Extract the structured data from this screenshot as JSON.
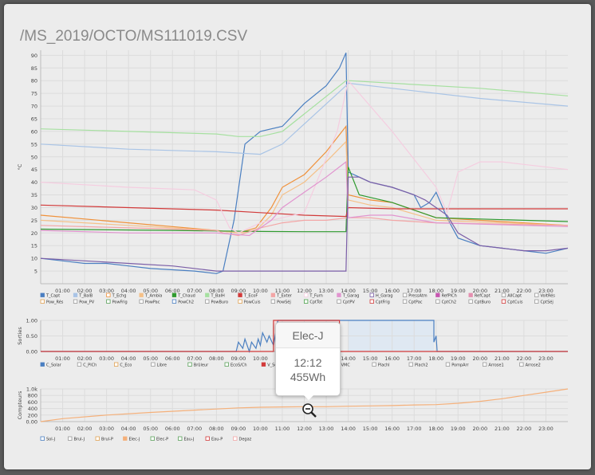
{
  "page": {
    "title": "/MS_2019/OCTO/MS111019.CSV"
  },
  "x_ticks": [
    "01:00",
    "02:00",
    "03:00",
    "04:00",
    "05:00",
    "06:00",
    "07:00",
    "08:00",
    "09:00",
    "10:00",
    "11:00",
    "12:00",
    "13:00",
    "14:00",
    "15:00",
    "16:00",
    "17:00",
    "18:00",
    "19:00",
    "20:00",
    "21:00",
    "22:00",
    "23:00"
  ],
  "tooltip": {
    "title": "Elec-J",
    "time": "12:12",
    "value": "455Wh"
  },
  "chart_data": [
    {
      "type": "line",
      "ylabel": "°C",
      "ylim": [
        0,
        92
      ],
      "yticks": [
        5,
        10,
        15,
        20,
        25,
        30,
        35,
        40,
        45,
        50,
        55,
        60,
        65,
        70,
        75,
        80,
        85,
        90
      ],
      "x_range_hours": [
        0,
        24
      ],
      "grid": true,
      "legend_placement": "bottom",
      "series": [
        {
          "name": "T_Capt",
          "color": "#4a7fc1",
          "x": [
            0,
            1,
            2,
            3,
            4,
            5,
            6,
            7,
            8,
            8.3,
            8.8,
            9.3,
            10,
            11,
            12,
            13,
            13.6,
            13.9,
            14,
            14.5,
            15,
            16,
            17,
            17.3,
            17.7,
            18,
            18.5,
            19,
            20,
            21,
            22,
            23,
            24
          ],
          "y": [
            10,
            9,
            8,
            8,
            7,
            6,
            5.5,
            5,
            4,
            5,
            25,
            55,
            60,
            62,
            71,
            78,
            85,
            91,
            44,
            42,
            40,
            38,
            35,
            30,
            32,
            36,
            26,
            18,
            15,
            14,
            13,
            12,
            14
          ]
        },
        {
          "name": "T_BalB",
          "color": "#a9c4e6",
          "x": [
            0,
            4,
            8,
            10,
            11,
            13.9,
            14,
            16,
            20,
            24
          ],
          "y": [
            55,
            53,
            52,
            51,
            55,
            78,
            79,
            77,
            73,
            70
          ]
        },
        {
          "name": "T_Echg",
          "color": "#f0913a",
          "x": [
            0,
            4,
            8,
            9,
            9.8,
            10.5,
            11,
            12,
            13,
            13.9,
            14,
            14.5,
            15,
            16,
            18,
            24
          ],
          "y": [
            27,
            24,
            21,
            20,
            22,
            30,
            38,
            43,
            52,
            62,
            35,
            34,
            33,
            32,
            26,
            23
          ]
        },
        {
          "name": "T_Ambia",
          "color": "#f5c088",
          "x": [
            0,
            4,
            8,
            9,
            9.8,
            10.5,
            11,
            12,
            13,
            13.9,
            14,
            14.5,
            15,
            16,
            18,
            24
          ],
          "y": [
            25,
            23,
            21,
            20,
            21,
            27,
            35,
            40,
            48,
            56,
            33,
            32,
            31,
            30,
            25,
            23
          ]
        },
        {
          "name": "T_Chaud",
          "color": "#2f9a2f",
          "x": [
            0,
            6,
            8,
            10,
            12,
            13.9,
            14,
            14.5,
            15,
            16,
            18,
            24
          ],
          "y": [
            21.5,
            21,
            20.8,
            20.6,
            20.5,
            20.5,
            46,
            35,
            34,
            32,
            26,
            24.5
          ]
        },
        {
          "name": "T_BalH",
          "color": "#a6e0a0",
          "x": [
            0,
            4,
            8,
            9,
            10,
            11,
            13.9,
            14,
            16,
            20,
            24
          ],
          "y": [
            61,
            60,
            59,
            58,
            58,
            60,
            80,
            80,
            79,
            77,
            74
          ]
        },
        {
          "name": "T_EcoF",
          "color": "#d23a3a",
          "x": [
            0,
            4,
            8,
            10,
            12,
            13.9,
            14,
            16,
            18,
            20,
            24
          ],
          "y": [
            31,
            30,
            29,
            28,
            27,
            26.5,
            30,
            29.5,
            29.5,
            29.5,
            29.5
          ]
        },
        {
          "name": "T_Exter",
          "color": "#f3a6a6",
          "x": [
            0,
            4,
            8,
            8.3,
            9,
            10,
            11,
            12,
            13,
            14,
            15,
            16,
            18,
            24
          ],
          "y": [
            23,
            22,
            21,
            20,
            19,
            22,
            24,
            25,
            25,
            26,
            26,
            25,
            24,
            23
          ]
        },
        {
          "name": "T_Furn",
          "color": "#f5cde0",
          "x": [
            0,
            4,
            7,
            8,
            8.6,
            9,
            9.5,
            10,
            11,
            12,
            13.5,
            14,
            16,
            18,
            18.5,
            19,
            20,
            21,
            22,
            24
          ],
          "y": [
            40,
            38,
            37,
            33,
            22,
            20,
            22,
            24,
            26,
            28,
            60,
            80,
            60,
            38,
            28,
            44,
            48,
            48,
            47,
            45
          ]
        },
        {
          "name": "T_Garag",
          "color": "#e194cf",
          "x": [
            0,
            4,
            8,
            9.5,
            10.5,
            11,
            12,
            13,
            13.9,
            14,
            15,
            16,
            18,
            24
          ],
          "y": [
            21,
            20,
            20,
            19,
            25,
            30,
            36,
            42,
            48,
            26,
            27,
            27,
            24,
            22.5
          ]
        },
        {
          "name": "H_Garag",
          "color": "#7b5ea7",
          "x": [
            0,
            2,
            4,
            6,
            8,
            8.5,
            9,
            10,
            12,
            13,
            13.9,
            14,
            14.5,
            15,
            16,
            17,
            17.5,
            18,
            18.5,
            19,
            20,
            21,
            22,
            23,
            24
          ],
          "y": [
            10,
            9,
            8,
            7,
            5,
            5,
            5,
            5,
            5,
            5,
            5,
            42,
            42,
            40,
            38,
            35,
            33,
            30,
            27,
            20,
            15,
            14,
            13,
            13,
            14
          ]
        }
      ],
      "legend_row1": [
        {
          "name": "T_Capt",
          "color": "#4a7fc1",
          "filled": true
        },
        {
          "name": "T_BalB",
          "color": "#a9c4e6",
          "filled": true
        },
        {
          "name": "T_Echg",
          "color": "#f0913a",
          "filled": false
        },
        {
          "name": "T_Ambia",
          "color": "#f5c088",
          "filled": true
        },
        {
          "name": "T_Chaud",
          "color": "#2f9a2f",
          "filled": true
        },
        {
          "name": "T_BalH",
          "color": "#a6e0a0",
          "filled": true
        },
        {
          "name": "T_EcoF",
          "color": "#d23a3a",
          "filled": true
        },
        {
          "name": "T_Exter",
          "color": "#f3a6a6",
          "filled": true
        },
        {
          "name": "T_Furn",
          "color": "#f5cde0",
          "filled": false
        },
        {
          "name": "T_Garag",
          "color": "#e194cf",
          "filled": true
        },
        {
          "name": "H_Garag",
          "color": "#7b5ea7",
          "filled": false
        },
        {
          "name": "PressAtm",
          "color": "#999999",
          "filled": false
        },
        {
          "name": "RefPlCh",
          "color": "#c655b0",
          "filled": true
        },
        {
          "name": "RefCapt",
          "color": "#e58fb0",
          "filled": true
        },
        {
          "name": "AllCapt",
          "color": "#999999",
          "filled": false
        },
        {
          "name": "VoltRés",
          "color": "#999999",
          "filled": false
        }
      ],
      "legend_row2": [
        {
          "name": "Pow_Rés",
          "color": "#e0a050",
          "filled": false
        },
        {
          "name": "Pow_PV",
          "color": "#999999",
          "filled": false
        },
        {
          "name": "PowFrig",
          "color": "#5aa05a",
          "filled": false
        },
        {
          "name": "PowPac",
          "color": "#999999",
          "filled": false
        },
        {
          "name": "PowCh2",
          "color": "#4a7fc1",
          "filled": false
        },
        {
          "name": "PowBuro",
          "color": "#999999",
          "filled": false
        },
        {
          "name": "PowCuis",
          "color": "#e0a050",
          "filled": false
        },
        {
          "name": "PowSéj",
          "color": "#999999",
          "filled": false
        },
        {
          "name": "CptTot",
          "color": "#4aa04a",
          "filled": false
        },
        {
          "name": "CptPV",
          "color": "#999999",
          "filled": false
        },
        {
          "name": "CptFrig",
          "color": "#d23a3a",
          "filled": false
        },
        {
          "name": "CptPac",
          "color": "#999999",
          "filled": false
        },
        {
          "name": "CptCh2",
          "color": "#999999",
          "filled": false
        },
        {
          "name": "CptBuro",
          "color": "#999999",
          "filled": false
        },
        {
          "name": "CptCuis",
          "color": "#d23a3a",
          "filled": false
        },
        {
          "name": "CptSéj",
          "color": "#999999",
          "filled": false
        }
      ]
    },
    {
      "type": "line",
      "ylabel": "Sorties",
      "ylim": [
        0,
        1
      ],
      "yticks": [
        "0.00",
        "0.50",
        "1.00"
      ],
      "x_range_hours": [
        0,
        24
      ],
      "series": [
        {
          "name": "C_Solar",
          "color": "#4a7fc1",
          "x": [
            0,
            8.9,
            9,
            9.2,
            9.3,
            9.5,
            9.6,
            9.8,
            9.9,
            10,
            10.1,
            10.3,
            10.4,
            10.6,
            10.8,
            11,
            13.5,
            14,
            17.9,
            17.9,
            18,
            18.05,
            24
          ],
          "y": [
            0,
            0,
            0.3,
            0.1,
            0.4,
            0,
            0.3,
            0.1,
            0.4,
            0.2,
            0.6,
            0.3,
            0.5,
            0.2,
            1,
            1,
            1,
            1,
            1,
            0.3,
            0.5,
            0,
            0
          ]
        },
        {
          "name": "V_SerH",
          "color": "#d23a3a",
          "x": [
            0,
            10.6,
            10.6,
            13.6,
            13.6,
            14,
            14,
            24
          ],
          "y": [
            0,
            0,
            1,
            1,
            0,
            0,
            0,
            0
          ]
        }
      ],
      "legend": [
        {
          "name": "C_Solar",
          "color": "#4a7fc1",
          "filled": true
        },
        {
          "name": "C_PlCh",
          "color": "#999999",
          "filled": false
        },
        {
          "name": "C_Eco",
          "color": "#e0a050",
          "filled": false
        },
        {
          "name": "Libre",
          "color": "#999999",
          "filled": false
        },
        {
          "name": "Brûleur",
          "color": "#5aa05a",
          "filled": false
        },
        {
          "name": "EcoS/Ch",
          "color": "#5aa05a",
          "filled": false
        },
        {
          "name": "V_SerH",
          "color": "#d23a3a",
          "filled": true
        },
        {
          "name": "V_SerB",
          "color": "#f3a6a6",
          "filled": true
        },
        {
          "name": "VMC",
          "color": "#a9a9e6",
          "filled": false
        },
        {
          "name": "Plachl",
          "color": "#999999",
          "filled": false
        },
        {
          "name": "Plach2",
          "color": "#999999",
          "filled": false
        },
        {
          "name": "PompArr",
          "color": "#999999",
          "filled": false
        },
        {
          "name": "Arrose1",
          "color": "#999999",
          "filled": false
        },
        {
          "name": "Arrose2",
          "color": "#999999",
          "filled": false
        }
      ]
    },
    {
      "type": "line",
      "ylabel": "Compteurs",
      "ylim": [
        0,
        1000
      ],
      "yticks": [
        "0.00",
        "200",
        "400",
        "600",
        "800",
        "1.0k"
      ],
      "x_range_hours": [
        0,
        24
      ],
      "series": [
        {
          "name": "Elec-J",
          "color": "#f5b07a",
          "x": [
            0,
            1,
            3,
            5,
            7,
            9,
            10,
            11,
            12,
            13,
            14,
            15,
            16,
            17,
            18,
            19,
            20,
            21,
            22,
            23,
            24
          ],
          "y": [
            0,
            90,
            200,
            280,
            350,
            420,
            440,
            450,
            455,
            455,
            470,
            480,
            490,
            510,
            520,
            560,
            620,
            700,
            800,
            900,
            1000
          ]
        }
      ],
      "legend": [
        {
          "name": "Sol-J",
          "color": "#4a7fc1",
          "filled": false
        },
        {
          "name": "Brul-J",
          "color": "#999999",
          "filled": false
        },
        {
          "name": "Brul-P",
          "color": "#e0a050",
          "filled": false
        },
        {
          "name": "Elec-J",
          "color": "#f5b07a",
          "filled": true
        },
        {
          "name": "Elec-P",
          "color": "#5aa05a",
          "filled": false
        },
        {
          "name": "Eau-J",
          "color": "#5aa05a",
          "filled": false
        },
        {
          "name": "Eau-P",
          "color": "#d23a3a",
          "filled": false
        },
        {
          "name": "Degaz",
          "color": "#f3a6a6",
          "filled": false
        }
      ]
    }
  ]
}
